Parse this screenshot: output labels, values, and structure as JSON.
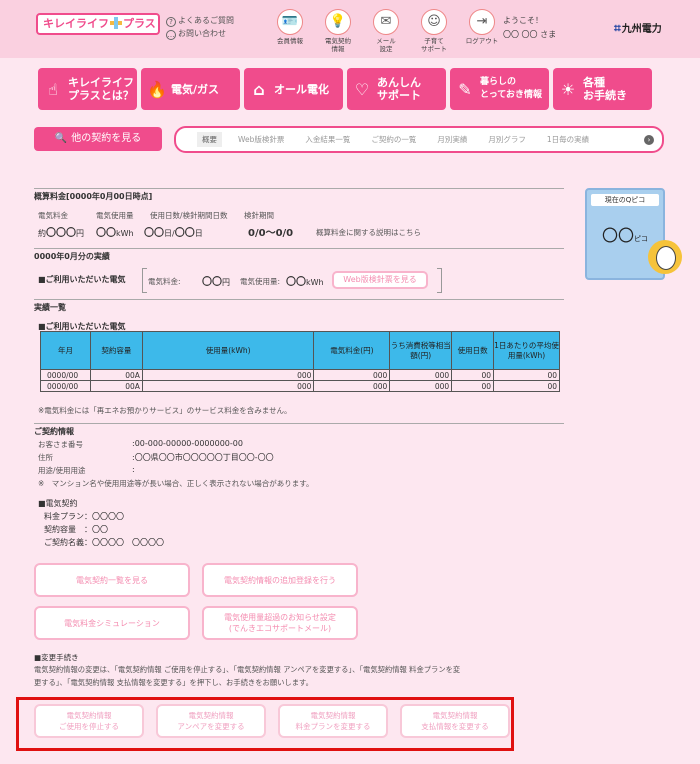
{
  "header": {
    "logo": {
      "part1": "キレイライフ",
      "part2": "プラス"
    },
    "faq": "よくあるご質問",
    "contact": "お問い合わせ",
    "nav": [
      {
        "icon": "member-card-icon",
        "glyph": "🪪",
        "label1": "会員情報",
        "label2": ""
      },
      {
        "icon": "bulb-icon",
        "glyph": "💡",
        "label1": "電気契約",
        "label2": "情報"
      },
      {
        "icon": "mail-icon",
        "glyph": "✉",
        "label1": "メール",
        "label2": "設定"
      },
      {
        "icon": "baby-icon",
        "glyph": "☺",
        "label1": "子育て",
        "label2": "サポート"
      },
      {
        "icon": "logout-icon",
        "glyph": "⇥",
        "label1": "ログアウト",
        "label2": ""
      }
    ],
    "welcome": "ようこそ！",
    "user": "〇〇 〇〇 さま",
    "company": "九州電力",
    "company_mark": "⌗"
  },
  "main_nav": [
    {
      "icon": "hand-icon",
      "glyph": "☝",
      "label1": "キレイライフ",
      "label2": "プラスとは？"
    },
    {
      "icon": "flame-icon",
      "glyph": "🔥",
      "label1": "電気/ガス",
      "label2": ""
    },
    {
      "icon": "house-icon",
      "glyph": "⌂",
      "label1": "オール電化",
      "label2": ""
    },
    {
      "icon": "heart-icon",
      "glyph": "♡",
      "label1": "あんしん",
      "label2": "サポート"
    },
    {
      "icon": "tips-icon",
      "glyph": "✎",
      "label1": "暮らしの",
      "label2": "とっておき情報"
    },
    {
      "icon": "lightbulb-icon",
      "glyph": "☀",
      "label1": "各種",
      "label2": "お手続き"
    }
  ],
  "other_contracts": "他の契約を見る",
  "tabs": [
    "概要",
    "Web版検針票",
    "入金結果一覧",
    "ご契約の一覧",
    "月別実績",
    "月別グラフ",
    "1日毎の実績"
  ],
  "estimate": {
    "title": "概算料金[0000年0月00日時点]",
    "labels": [
      "電気料金",
      "電気使用量",
      "使用日数/検針期間日数",
      "検針期間"
    ],
    "fee_prefix": "約",
    "fee": "〇〇〇",
    "fee_unit": "円",
    "usage": "〇〇",
    "usage_unit": "kWh",
    "days_a": "〇〇",
    "days_sep": "日/",
    "days_b": "〇〇",
    "days_unit": "日",
    "period": "0/0〜0/0",
    "note": "概算料金に関する説明はこちら"
  },
  "monthly": {
    "title": "0000年0月分の実績",
    "subtitle": "■ご利用いただいた電気",
    "fee_label": "電気料金:",
    "fee": "〇〇",
    "fee_unit": "円",
    "usage_label": "電気使用量:",
    "usage": "〇〇",
    "usage_unit": "kWh",
    "web_button": "Web版検針票を見る"
  },
  "results": {
    "title": "実績一覧",
    "subtitle": "■ご利用いただいた電気",
    "headers": [
      "年月",
      "契約容量",
      "使用量(kWh)",
      "電気料金(円)",
      "うち消費税等相当額(円)",
      "使用日数",
      "1日あたりの平均使用量(kWh)"
    ],
    "rows": [
      [
        "0000/00",
        "00A",
        "000",
        "000",
        "000",
        "00",
        "00"
      ],
      [
        "0000/00",
        "00A",
        "000",
        "000",
        "000",
        "00",
        "00"
      ]
    ],
    "note": "※電気料金には「再エネお預かりサービス」のサービス料金を含みません。"
  },
  "contract": {
    "title": "ご契約情報",
    "customer_label": "お客さま番号",
    "customer": ":00-000-00000-0000000-00",
    "address_label": "住所",
    "address": ":〇〇県〇〇市〇〇〇〇〇丁目〇〇-〇〇",
    "use_label": "用途/使用用途",
    "use": ":",
    "note": "※　マンション名や使用用途等が長い場合、正しく表示されない場合があります。",
    "elec_title": "■電気契約",
    "plan": "料金プラン：〇〇〇〇",
    "capacity": "契約容量　：〇〇",
    "holder": "ご契約名義：〇〇〇〇　〇〇〇〇"
  },
  "buttons": {
    "list": "電気契約一覧を見る",
    "add": "電気契約情報の追加登録を行う",
    "sim": "電気料金シミュレーション",
    "notify1": "電気使用量超過のお知らせ設定",
    "notify2": "(でんきエコサポートメール)"
  },
  "change": {
    "title": "■変更手続き",
    "desc1": "電気契約情報の変更は、「電気契約情報 ご使用を停止する」、「電気契約情報 アンペアを変更する」、「電気契約情報 料金プランを変",
    "desc2": "更する」、「電気契約情報 支払情報を変更する」を押下し、お手続きをお願いします。",
    "buttons": [
      {
        "l1": "電気契約情報",
        "l2": "ご使用を停止する"
      },
      {
        "l1": "電気契約情報",
        "l2": "アンペアを変更する"
      },
      {
        "l1": "電気契約情報",
        "l2": "料金プランを変更する"
      },
      {
        "l1": "電気契約情報",
        "l2": "支払情報を変更する"
      }
    ]
  },
  "qpico": {
    "title": "現在のQピコ",
    "value": "〇〇",
    "unit": "ピコ"
  }
}
